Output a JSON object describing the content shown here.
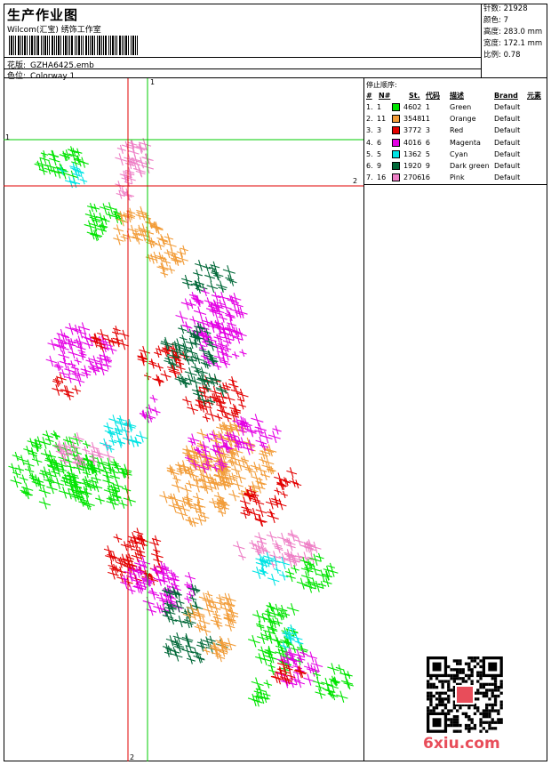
{
  "header": {
    "title": "生产作业图",
    "company": "Wilcom(汇宝) 绣饰工作室",
    "design_label": "花版:",
    "design_value": "GZHA6425.emb",
    "colorway_label": "色位:",
    "colorway_value": "Colorway 1"
  },
  "stats": [
    {
      "label": "针数:",
      "value": "21928"
    },
    {
      "label": "颜色:",
      "value": "7"
    },
    {
      "label": "高度:",
      "value": "283.0 mm"
    },
    {
      "label": "宽度:",
      "value": "172.1 mm"
    },
    {
      "label": "比例:",
      "value": "0.78"
    }
  ],
  "sequence": {
    "title": "停止顺序:",
    "headers": [
      "#",
      "N#",
      "St.",
      "代码",
      "描述",
      "Brand",
      "元素"
    ],
    "rows": [
      {
        "idx": "1.",
        "n": "1",
        "stitches": "4602",
        "code": "1",
        "desc": "Green",
        "brand": "Default",
        "color": "#00e400"
      },
      {
        "idx": "2.",
        "n": "11",
        "stitches": "3548",
        "code": "11",
        "desc": "Orange",
        "brand": "Default",
        "color": "#f29c38"
      },
      {
        "idx": "3.",
        "n": "3",
        "stitches": "3772",
        "code": "3",
        "desc": "Red",
        "brand": "Default",
        "color": "#e30000"
      },
      {
        "idx": "4.",
        "n": "6",
        "stitches": "4016",
        "code": "6",
        "desc": "Magenta",
        "brand": "Default",
        "color": "#e400e4"
      },
      {
        "idx": "5.",
        "n": "5",
        "stitches": "1362",
        "code": "5",
        "desc": "Cyan",
        "brand": "Default",
        "color": "#00e4e4"
      },
      {
        "idx": "6.",
        "n": "9",
        "stitches": "1920",
        "code": "9",
        "desc": "Dark green",
        "brand": "Default",
        "color": "#006838"
      },
      {
        "idx": "7.",
        "n": "16",
        "stitches": "2706",
        "code": "16",
        "desc": "Pink",
        "brand": "Default",
        "color": "#ee7fc6"
      }
    ]
  },
  "guides": {
    "h1": "1",
    "h2": "2",
    "v1": "1",
    "v2": "2",
    "green": "#00cc00",
    "red": "#e00000"
  },
  "watermark": "6xiu.com"
}
